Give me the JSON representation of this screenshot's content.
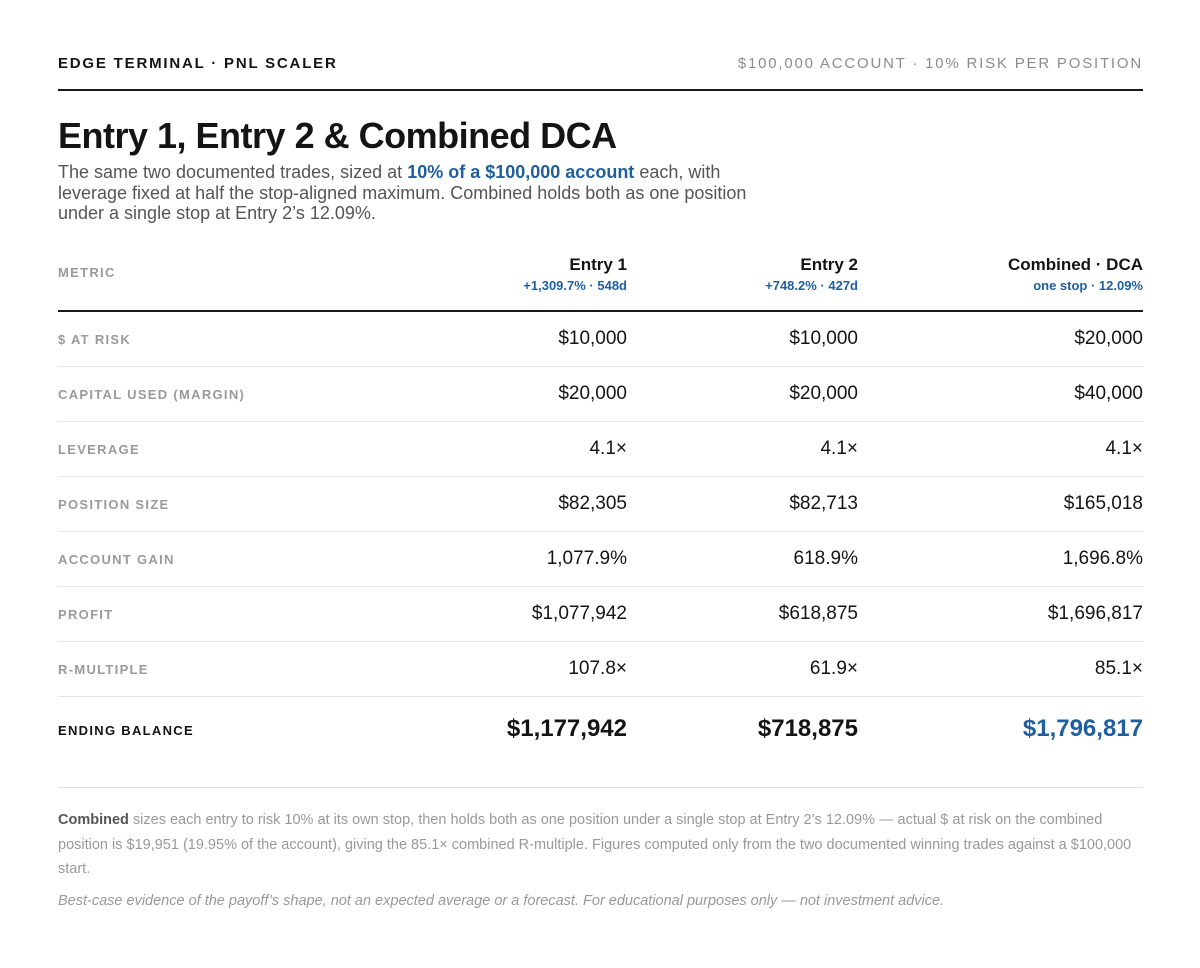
{
  "header": {
    "brand": "EDGE TERMINAL · PNL SCALER",
    "account": "$100,000 ACCOUNT · 10% RISK PER POSITION"
  },
  "title": "Entry 1, Entry 2 & Combined DCA",
  "intro": {
    "before": "The same two documented trades, sized at ",
    "highlight": "10% of a $100,000 account",
    "after": " each, with leverage fixed at half the stop-aligned maximum. Combined holds both as one position under a single stop at Entry 2’s 12.09%."
  },
  "table": {
    "metric_header": "METRIC",
    "columns": [
      {
        "name": "Entry 1",
        "sub": "+1,309.7% · 548d"
      },
      {
        "name": "Entry 2",
        "sub": "+748.2% · 427d"
      },
      {
        "name": "Combined · DCA",
        "sub": "one stop · 12.09%"
      }
    ],
    "rows": [
      {
        "label": "$ AT RISK",
        "values": [
          "$10,000",
          "$10,000",
          "$20,000"
        ]
      },
      {
        "label": "CAPITAL USED (MARGIN)",
        "values": [
          "$20,000",
          "$20,000",
          "$40,000"
        ]
      },
      {
        "label": "LEVERAGE",
        "values": [
          "4.1×",
          "4.1×",
          "4.1×"
        ]
      },
      {
        "label": "POSITION SIZE",
        "values": [
          "$82,305",
          "$82,713",
          "$165,018"
        ]
      },
      {
        "label": "ACCOUNT GAIN",
        "values": [
          "1,077.9%",
          "618.9%",
          "1,696.8%"
        ]
      },
      {
        "label": "PROFIT",
        "values": [
          "$1,077,942",
          "$618,875",
          "$1,696,817"
        ]
      },
      {
        "label": "R-MULTIPLE",
        "values": [
          "107.8×",
          "61.9×",
          "85.1×"
        ]
      },
      {
        "label": "ENDING BALANCE",
        "values": [
          "$1,177,942",
          "$718,875",
          "$1,796,817"
        ]
      }
    ]
  },
  "note": {
    "bold": "Combined",
    "text": " sizes each entry to risk 10% at its own stop, then holds both as one position under a single stop at Entry 2’s 12.09% — actual $ at risk on the combined position is $19,951 (19.95% of the account), giving the 85.1× combined R-multiple. Figures computed only from the two documented winning trades against a $100,000 start."
  },
  "disclaimer": "Best-case evidence of the payoff’s shape, not an expected average or a forecast. For educational purposes only — not investment advice.",
  "colors": {
    "accent": "#1f5f9e",
    "text": "#141414",
    "muted": "#9a9a9a"
  }
}
